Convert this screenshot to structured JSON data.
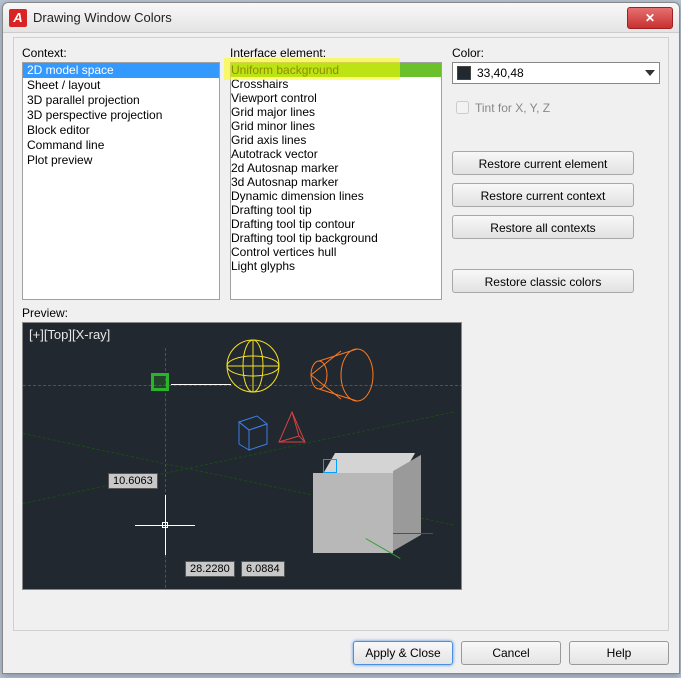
{
  "window": {
    "title": "Drawing Window Colors",
    "app_icon_letter": "A",
    "close_symbol": "✕"
  },
  "labels": {
    "context": "Context:",
    "interface_element": "Interface element:",
    "color": "Color:",
    "tint": "Tint for X, Y, Z",
    "preview": "Preview:"
  },
  "context_list": {
    "items": [
      "2D model space",
      "Sheet / layout",
      "3D parallel projection",
      "3D perspective projection",
      "Block editor",
      "Command line",
      "Plot preview"
    ],
    "selected_index": 0
  },
  "interface_list": {
    "items": [
      "Uniform background",
      "Crosshairs",
      "Viewport control",
      "Grid major lines",
      "Grid minor lines",
      "Grid axis lines",
      "Autotrack vector",
      "2d Autosnap marker",
      "3d Autosnap marker",
      "Dynamic dimension lines",
      "Drafting tool tip",
      "Drafting tool tip contour",
      "Drafting tool tip background",
      "Control vertices hull",
      "Light glyphs"
    ],
    "selected_index": 0
  },
  "color": {
    "value": "33,40,48",
    "swatch_hex": "#212830"
  },
  "buttons": {
    "restore_current_element": "Restore current element",
    "restore_current_context": "Restore current context",
    "restore_all_contexts": "Restore all contexts",
    "restore_classic_colors": "Restore classic colors",
    "apply_close": "Apply & Close",
    "cancel": "Cancel",
    "help": "Help"
  },
  "preview": {
    "viewport_label": "[+][Top][X-ray]",
    "measure1": "10.6063",
    "measure2": "28.2280",
    "measure3": "6.0884"
  }
}
